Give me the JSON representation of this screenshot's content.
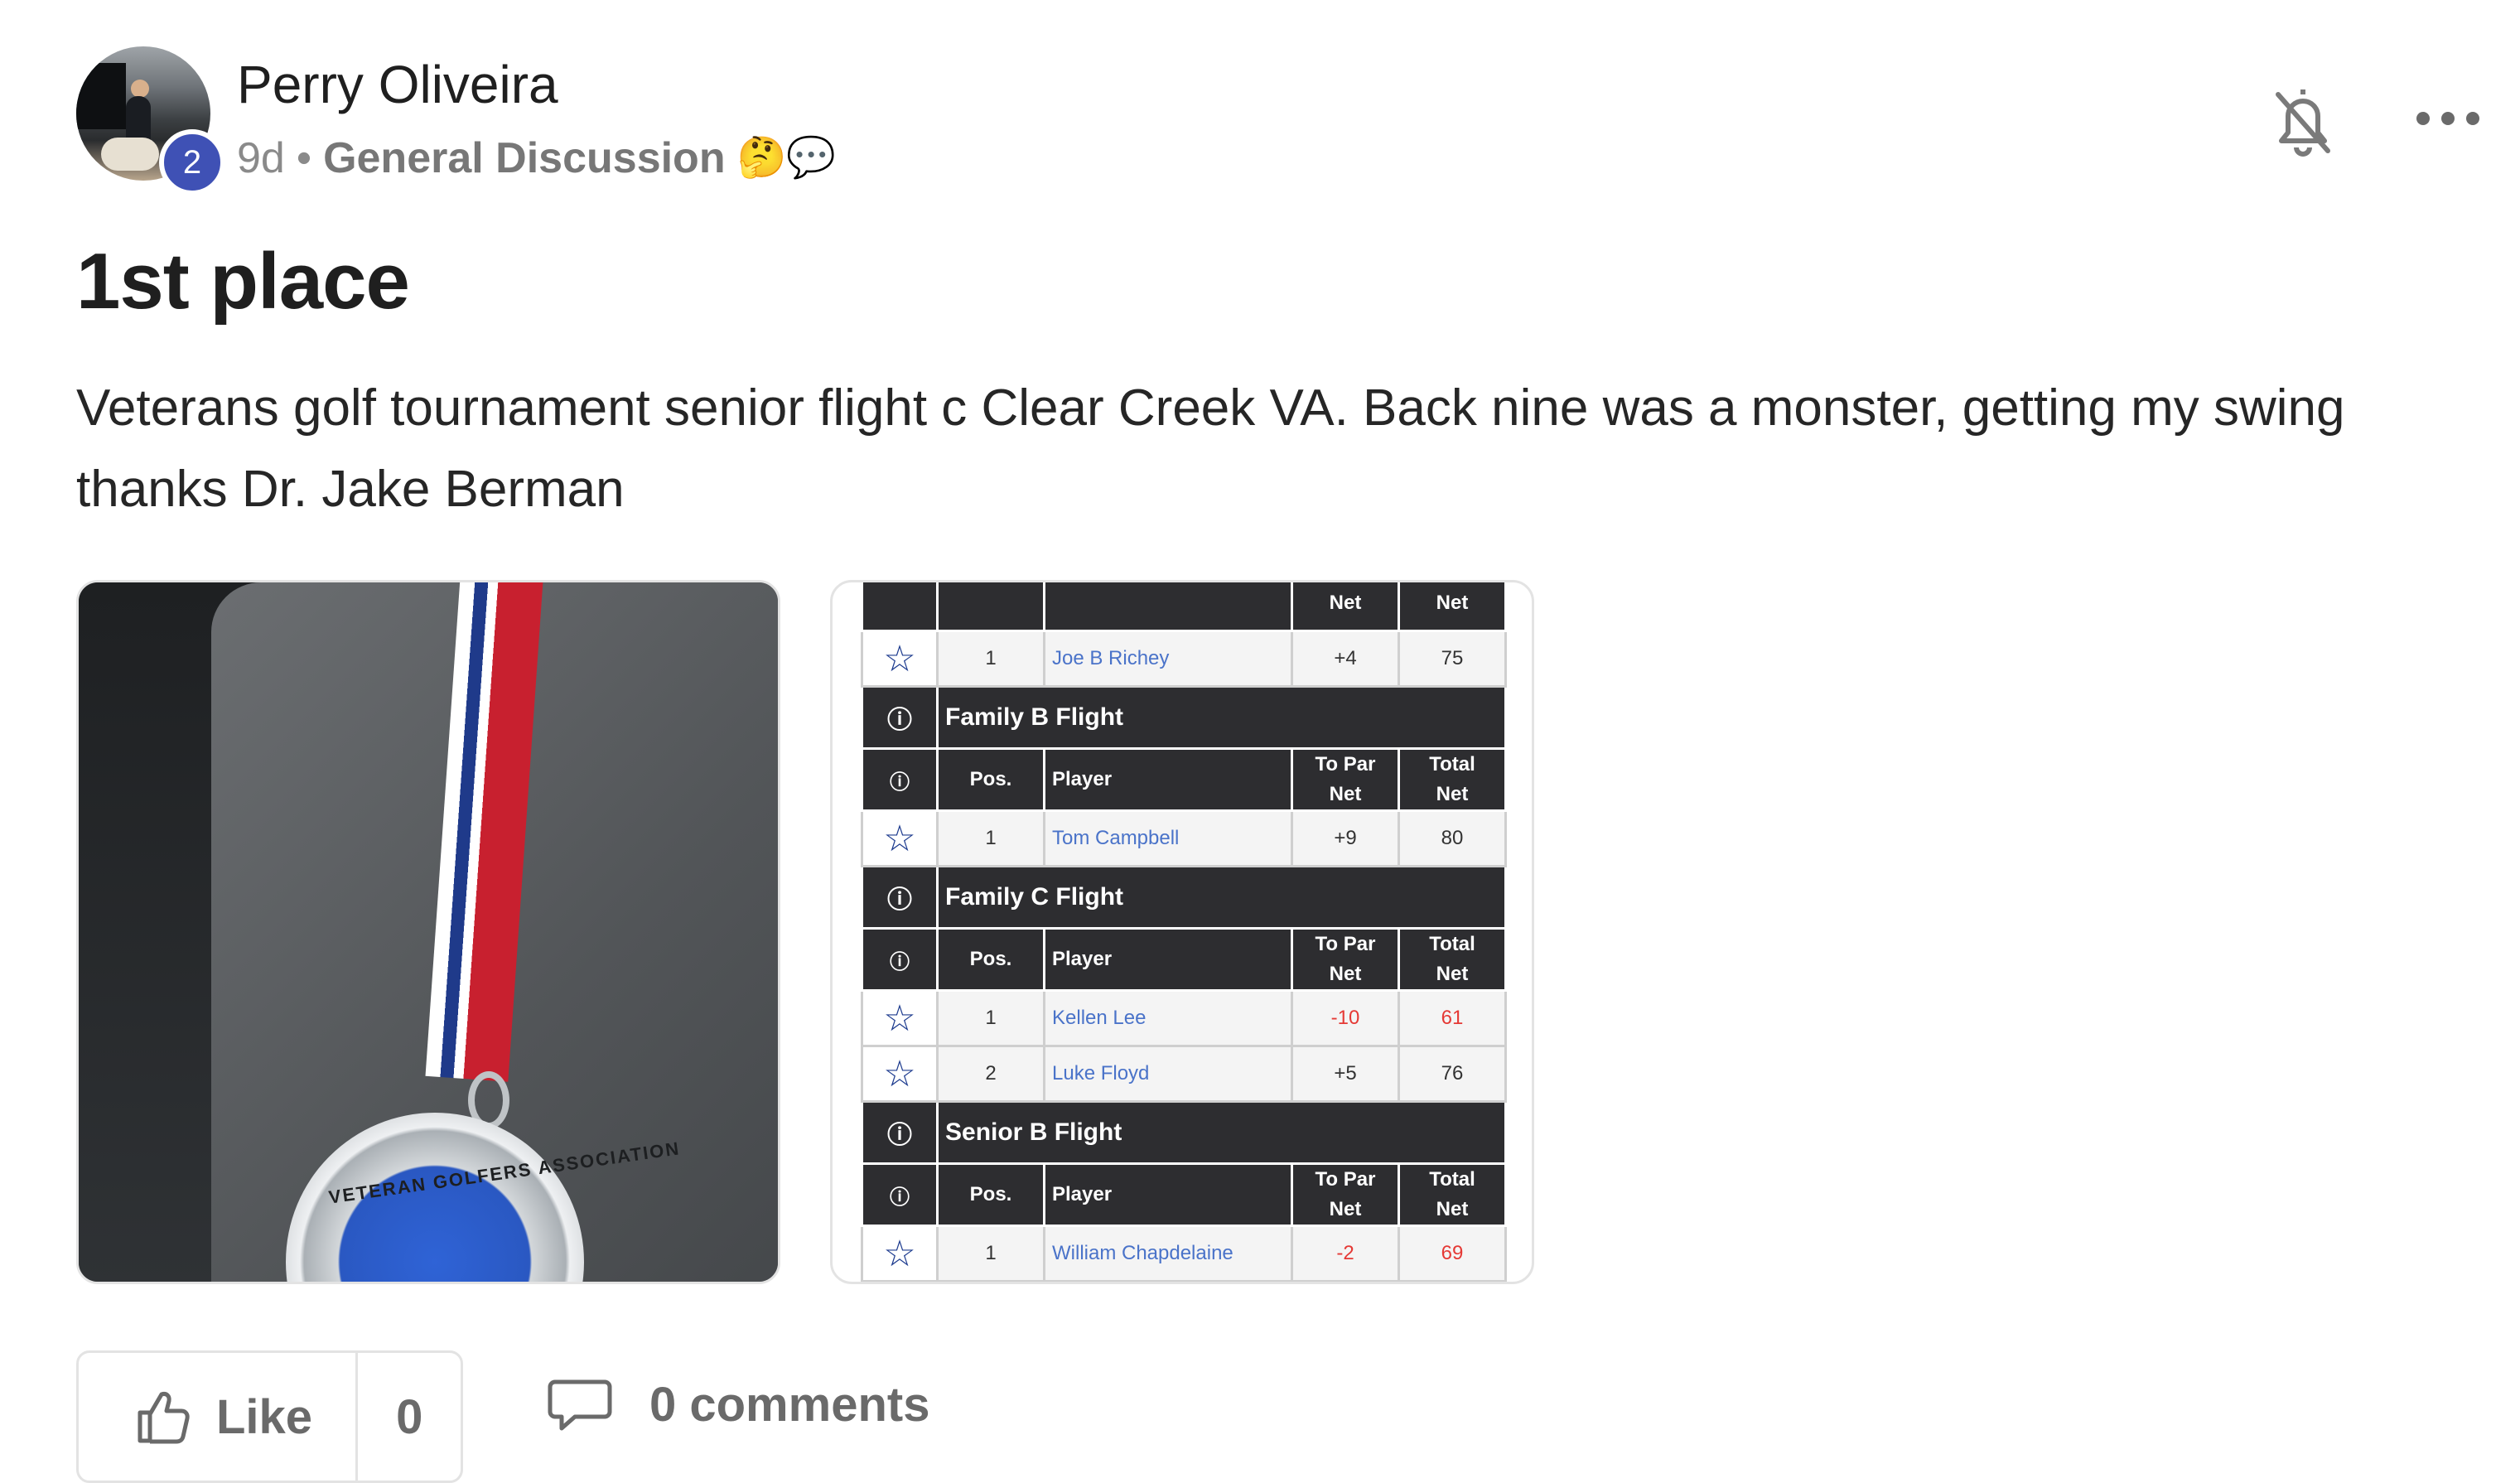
{
  "post": {
    "author": "Perry Oliveira",
    "level": "2",
    "age": "9d",
    "separator": "•",
    "category": "General Discussion",
    "category_emoji": "🤔💬",
    "title": "1st place",
    "body": "Veterans golf tournament senior flight c Clear Creek VA. Back nine was a monster, getting my swing thanks Dr. Jake Berman"
  },
  "header_icons": {
    "bell": "bell-off-icon",
    "more": "more-horizontal-icon"
  },
  "media": {
    "photo": {
      "medal_text": "VETERAN GOLFERS ASSOCIATION"
    },
    "leaderboard": {
      "partial_header": {
        "col3": "Net",
        "col4": "Net"
      },
      "partial_rows": [
        {
          "pos": "1",
          "player": "Joe B Richey",
          "to_par": "+4",
          "total": "75"
        }
      ],
      "headers": {
        "pos": "Pos.",
        "player": "Player",
        "to_par": "To Par",
        "net": "Net",
        "total": "Total"
      },
      "flights": [
        {
          "name": "Family B Flight",
          "rows": [
            {
              "pos": "1",
              "player": "Tom Campbell",
              "to_par": "+9",
              "total": "80"
            }
          ]
        },
        {
          "name": "Family C Flight",
          "rows": [
            {
              "pos": "1",
              "player": "Kellen Lee",
              "to_par": "-10",
              "total": "61"
            },
            {
              "pos": "2",
              "player": "Luke Floyd",
              "to_par": "+5",
              "total": "76"
            }
          ]
        },
        {
          "name": "Senior B Flight",
          "rows": [
            {
              "pos": "1",
              "player": "William Chapdelaine",
              "to_par": "-2",
              "total": "69"
            }
          ]
        }
      ],
      "icons": {
        "info": "info-icon",
        "star": "star-outline-icon"
      }
    }
  },
  "actions": {
    "like_label": "Like",
    "like_count": "0",
    "comments_label": "0 comments"
  },
  "colors": {
    "level_badge": "#3f51b5",
    "negative": "#e53935",
    "link": "#4a73c9",
    "table_header": "#2d2d30"
  }
}
